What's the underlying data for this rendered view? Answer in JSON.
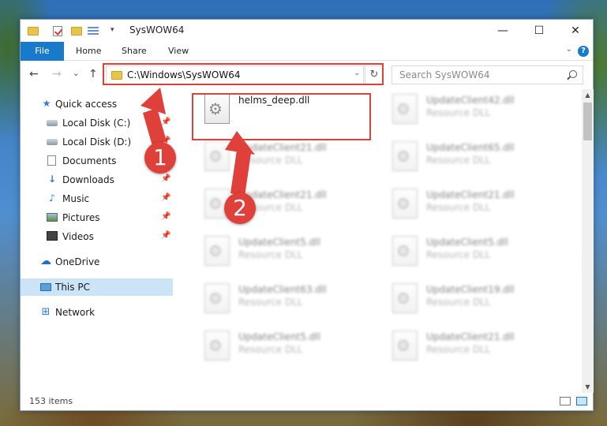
{
  "window": {
    "title": "SysWOW64",
    "minimize": "—",
    "maximize": "☐",
    "close": "✕"
  },
  "ribbon": {
    "tabs": [
      "File",
      "Home",
      "Share",
      "View"
    ],
    "help": "?",
    "collapse": "⌄"
  },
  "navigation": {
    "back": "←",
    "forward": "→",
    "recent": "⌄",
    "up": "↑",
    "address": "C:\\Windows\\SysWOW64",
    "address_dropdown": "⌄",
    "refresh": "↻",
    "search_placeholder": "Search SysWOW64"
  },
  "sidebar": {
    "items": [
      {
        "label": "Quick access",
        "icon": "star-icon",
        "pinned": false
      },
      {
        "label": "Local Disk (C:)",
        "icon": "disk-icon",
        "pinned": true
      },
      {
        "label": "Local Disk (D:)",
        "icon": "disk-icon",
        "pinned": true
      },
      {
        "label": "Documents",
        "icon": "document-icon",
        "pinned": true
      },
      {
        "label": "Downloads",
        "icon": "download-icon",
        "pinned": true
      },
      {
        "label": "Music",
        "icon": "music-icon",
        "pinned": true
      },
      {
        "label": "Pictures",
        "icon": "pictures-icon",
        "pinned": true
      },
      {
        "label": "Videos",
        "icon": "videos-icon",
        "pinned": true
      },
      {
        "label": "OneDrive",
        "icon": "cloud-icon",
        "pinned": false
      },
      {
        "label": "This PC",
        "icon": "computer-icon",
        "pinned": false,
        "selected": true
      },
      {
        "label": "Network",
        "icon": "network-icon",
        "pinned": false
      }
    ],
    "pin_glyph": "📌"
  },
  "files": {
    "left": [
      {
        "name": "helms_deep.dll",
        "type": "",
        "highlighted": true
      },
      {
        "name": "UpdateClient21.dll",
        "type": "Resource DLL"
      },
      {
        "name": "UpdateClient21.dll",
        "type": "Resource DLL"
      },
      {
        "name": "UpdateClient5.dll",
        "type": "Resource DLL"
      },
      {
        "name": "UpdateClient63.dll",
        "type": "Resource DLL"
      },
      {
        "name": "UpdateClient5.dll",
        "type": "Resource DLL"
      }
    ],
    "right": [
      {
        "name": "UpdateClient42.dll",
        "type": "Resource DLL"
      },
      {
        "name": "UpdateClient65.dll",
        "type": "Resource DLL"
      },
      {
        "name": "UpdateClient21.dll",
        "type": "Resource DLL"
      },
      {
        "name": "UpdateClient5.dll",
        "type": "Resource DLL"
      },
      {
        "name": "UpdateClient19.dll",
        "type": "Resource DLL"
      },
      {
        "name": "UpdateClient21.dll",
        "type": "Resource DLL"
      }
    ]
  },
  "status": {
    "item_count": "153 items"
  },
  "annotations": {
    "step1": "1",
    "step2": "2",
    "color": "#e0403a"
  },
  "scroll": {
    "up": "▲",
    "down": "▼"
  }
}
